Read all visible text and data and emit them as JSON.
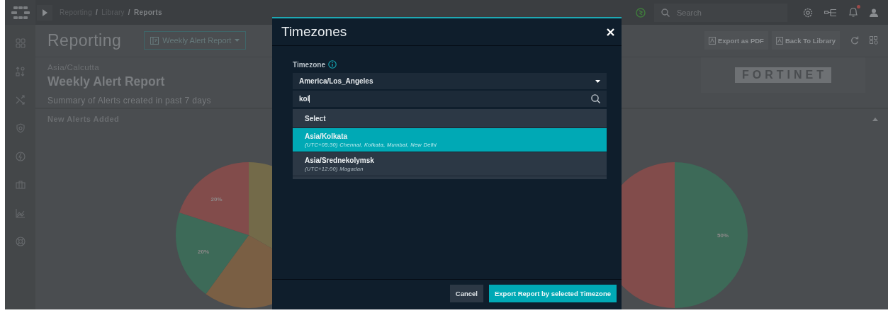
{
  "topbar": {
    "breadcrumb": [
      {
        "label": "Reporting",
        "current": false
      },
      {
        "separator": "/",
        "label": "Library",
        "current": false
      },
      {
        "separator": "/",
        "label": "Reports",
        "current": true
      }
    ],
    "search": {
      "placeholder": "Search"
    },
    "notification_badge": true
  },
  "page": {
    "title": "Reporting",
    "report_select": "Weekly Alert Report",
    "actions": [
      "Export as PDF",
      "Back To Library"
    ]
  },
  "report": {
    "timezone": "Asia/Calcutta",
    "title": "Weekly Alert Report",
    "subtitle": "Summary of Alerts created in past 7 days",
    "logo": "FORTINET"
  },
  "section": {
    "title": "New Alerts Added",
    "expanded": true,
    "left_pie_labels": [
      "20%",
      "20%"
    ],
    "right_pie_labels": [
      "50%"
    ]
  },
  "dialog": {
    "title": "Timezones",
    "field_label": "Timezone",
    "selected_value": "America/Los_Angeles",
    "search_value": "kol",
    "list_header": "Select",
    "options": [
      {
        "name": "Asia/Kolkata",
        "detail": "(UTC+05:30) Chennai, Kolkata, Mumbai, New Delhi",
        "selected": true
      },
      {
        "name": "Asia/Srednekolymsk",
        "detail": "(UTC+12:00) Magadan",
        "selected": false
      }
    ],
    "buttons": [
      {
        "label": "Cancel",
        "kind": "secondary"
      },
      {
        "label": "Export Report by selected Timezone",
        "kind": "primary"
      }
    ]
  }
}
